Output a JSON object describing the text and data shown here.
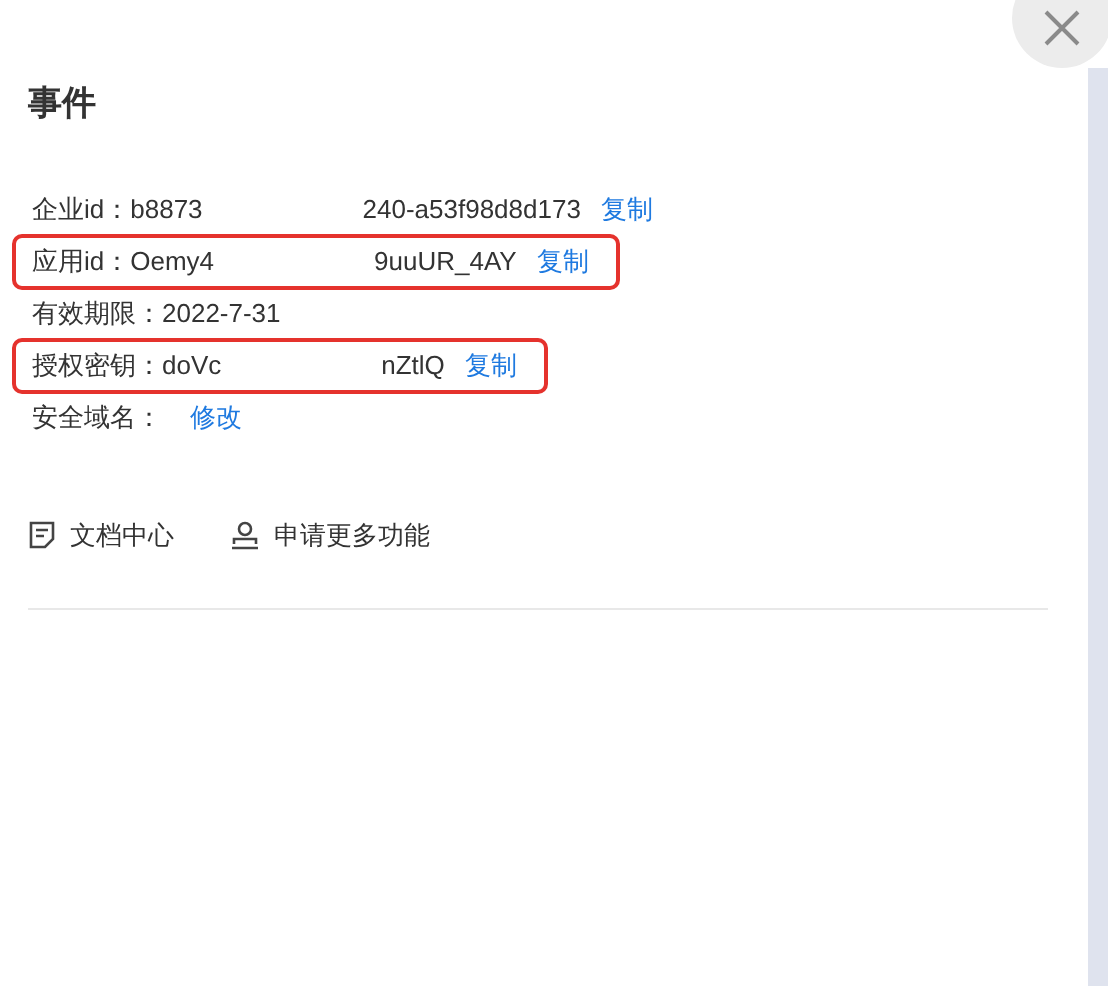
{
  "title": "事件",
  "rows": [
    {
      "label": "企业id：",
      "value_start": "b8873",
      "value_end": "240-a53f98d8d173",
      "action": "复制",
      "highlighted": false
    },
    {
      "label": "应用id：",
      "value_start": "Oemy4",
      "value_end": "9uuUR_4AY",
      "action": "复制",
      "highlighted": true
    },
    {
      "label": "有效期限：",
      "value_start": "2022-7-31",
      "highlighted": false
    },
    {
      "label": "授权密钥：",
      "value_start": "doVc",
      "value_end": "nZtlQ",
      "action": "复制",
      "highlighted": true
    },
    {
      "label": "安全域名：",
      "action": "修改",
      "highlighted": false
    }
  ],
  "links": [
    {
      "kind": "document",
      "label": "文档中心"
    },
    {
      "kind": "person",
      "label": "申请更多功能"
    }
  ]
}
